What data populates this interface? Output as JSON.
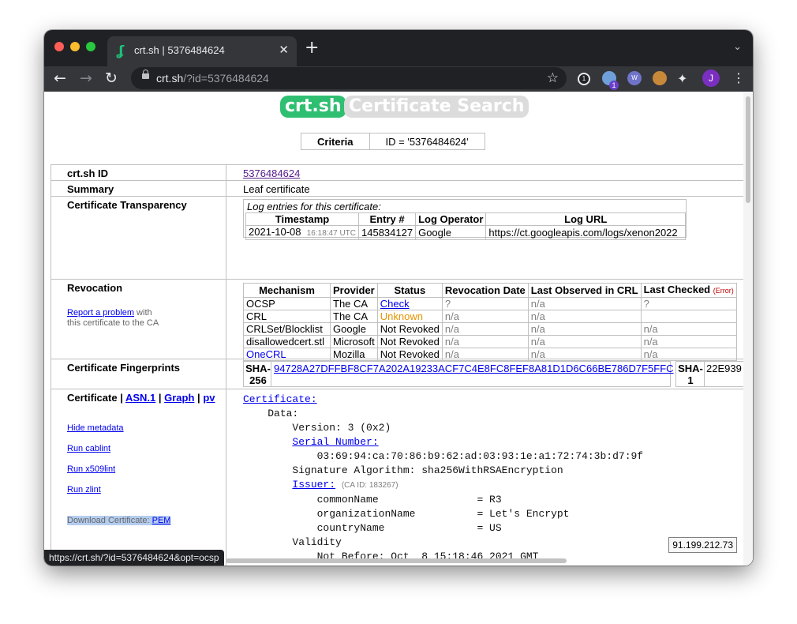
{
  "browser": {
    "tab_title": "crt.sh | 5376484624",
    "tab_close": "✕",
    "url_host": "crt.sh",
    "url_path": "/?id=5376484624",
    "status_url": "https://crt.sh/?id=5376484624&opt=ocsp",
    "profile_initial": "J",
    "ext_badge": "1",
    "favicon": "ʆ"
  },
  "logo": {
    "brand": "crt.sh",
    "title": "Certificate Search"
  },
  "criteria": {
    "label": "Criteria",
    "value": "ID = '5376484624'"
  },
  "rows": {
    "id": {
      "label": "crt.sh ID",
      "value": "5376484624"
    },
    "summary": {
      "label": "Summary",
      "value": "Leaf certificate"
    },
    "ct": {
      "label": "Certificate Transparency",
      "caption": "Log entries for this certificate:",
      "headers": [
        "Timestamp",
        "Entry #",
        "Log Operator",
        "Log URL"
      ],
      "entry": {
        "date": "2021-10-08",
        "time": "16:18:47 UTC",
        "num": "145834127",
        "operator": "Google",
        "url": "https://ct.googleapis.com/logs/xenon2022"
      }
    },
    "revocation": {
      "label": "Revocation",
      "report_link": "Report a problem",
      "report_suffix": " with",
      "report_line2": "this certificate to the CA",
      "headers": [
        "Mechanism",
        "Provider",
        "Status",
        "Revocation Date",
        "Last Observed in CRL",
        "Last Checked"
      ],
      "error_tag": "(Error)",
      "entries": [
        {
          "mechanism": "OCSP",
          "provider": "The CA",
          "status": "Check",
          "date": "?",
          "observed": "n/a",
          "checked": "?"
        },
        {
          "mechanism": "CRL",
          "provider": "The CA",
          "status": "Unknown",
          "date": "n/a",
          "observed": "n/a",
          "checked": ""
        },
        {
          "mechanism": "CRLSet/Blocklist",
          "provider": "Google",
          "status": "Not Revoked",
          "date": "n/a",
          "observed": "n/a",
          "checked": "n/a"
        },
        {
          "mechanism": "disallowedcert.stl",
          "provider": "Microsoft",
          "status": "Not Revoked",
          "date": "n/a",
          "observed": "n/a",
          "checked": "n/a"
        },
        {
          "mechanism": "OneCRL",
          "provider": "Mozilla",
          "status": "Not Revoked",
          "date": "n/a",
          "observed": "n/a",
          "checked": "n/a"
        }
      ]
    },
    "fingerprints": {
      "label": "Certificate Fingerprints",
      "sha256_label_1": "SHA-",
      "sha256_label_2": "256",
      "sha256": "94728A27DFFBF8CF7A202A19233ACF7C4E8FC8FEF8A81D1D6C66BE786D7F5FFC",
      "sha1_label_1": "SHA-",
      "sha1_label_2": "1",
      "sha1": "22E939"
    },
    "certificate": {
      "label": "Certificate",
      "asn1": "ASN.1",
      "graph": "Graph",
      "pv": "pv",
      "sep": " | ",
      "links": [
        "Hide metadata",
        "Run cablint",
        "Run x509lint",
        "Run zlint"
      ],
      "download_label": "Download Certificate:",
      "download_pem": "PEM",
      "lines": {
        "certificate": "Certificate:",
        "data": "Data:",
        "version": "Version: 3 (0x2)",
        "serial_label": "Serial Number:",
        "serial": "03:69:94:ca:70:86:b9:62:ad:03:93:1e:a1:72:74:3b:d7:9f",
        "sigalg": "Signature Algorithm: sha256WithRSAEncryption",
        "issuer": "Issuer:",
        "ca_id": "(CA ID: 183267)",
        "cn": "commonName                = R3",
        "org": "organizationName          = Let's Encrypt",
        "country": "countryName               = US",
        "validity": "Validity",
        "not_before": "Not Before: Oct  8 15:18:46 2021 GMT"
      }
    }
  },
  "ip_address": "91.199.212.73",
  "colors": {
    "brand_green": "#2fbf71",
    "logo_grey": "#d8d8d8",
    "unknown_orange": "#e69500",
    "error_red": "#c00000"
  }
}
